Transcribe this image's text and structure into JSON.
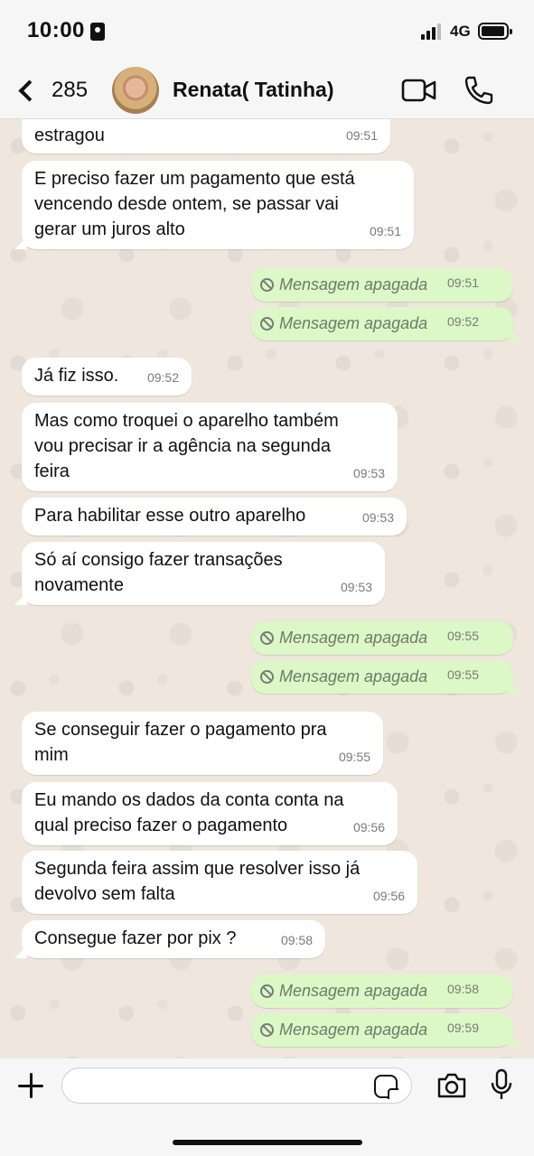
{
  "status_bar": {
    "time": "10:00",
    "network": "4G"
  },
  "header": {
    "back_count": "285",
    "contact_name": "Renata( Tatinha)"
  },
  "messages": [
    {
      "dir": "in",
      "text": "estragou",
      "time": "09:51"
    },
    {
      "dir": "in",
      "text": "E preciso fazer um pagamento que está\nvencendo desde ontem, se passar vai\ngerar um juros alto",
      "time": "09:51"
    },
    {
      "dir": "out",
      "text": "Mensagem apagada",
      "time": "09:51"
    },
    {
      "dir": "out",
      "text": "Mensagem apagada",
      "time": "09:52"
    },
    {
      "dir": "in",
      "text": "Já fiz isso.",
      "time": "09:52"
    },
    {
      "dir": "in",
      "text": "Mas como troquei o aparelho também\nvou precisar ir a agência na segunda\nfeira",
      "time": "09:53"
    },
    {
      "dir": "in",
      "text": "Para habilitar esse outro aparelho",
      "time": "09:53"
    },
    {
      "dir": "in",
      "text": "Só aí consigo fazer transações\nnovamente",
      "time": "09:53"
    },
    {
      "dir": "out",
      "text": "Mensagem apagada",
      "time": "09:55"
    },
    {
      "dir": "out",
      "text": "Mensagem apagada",
      "time": "09:55"
    },
    {
      "dir": "in",
      "text": "Se conseguir fazer o pagamento pra\nmim",
      "time": "09:55"
    },
    {
      "dir": "in",
      "text": "Eu mando os dados da conta conta na\nqual preciso fazer o pagamento",
      "time": "09:56"
    },
    {
      "dir": "in",
      "text": "Segunda feira assim que resolver isso já\ndevolvo sem falta",
      "time": "09:56"
    },
    {
      "dir": "in",
      "text": "Consegue fazer por pix ?",
      "time": "09:58"
    },
    {
      "dir": "out",
      "text": "Mensagem apagada",
      "time": "09:58"
    },
    {
      "dir": "out",
      "text": "Mensagem apagada",
      "time": "09:59"
    }
  ],
  "input": {
    "placeholder": ""
  },
  "icons": {
    "back": "chevron-left-icon",
    "video": "video-camera-icon",
    "call": "phone-icon",
    "add": "plus-icon",
    "sticker": "sticker-icon",
    "camera": "camera-icon",
    "mic": "microphone-icon",
    "deleted": "ban-icon"
  },
  "colors": {
    "incoming": "#ffffff",
    "outgoing": "#dbf8c6",
    "chat_bg": "#efe7de"
  }
}
